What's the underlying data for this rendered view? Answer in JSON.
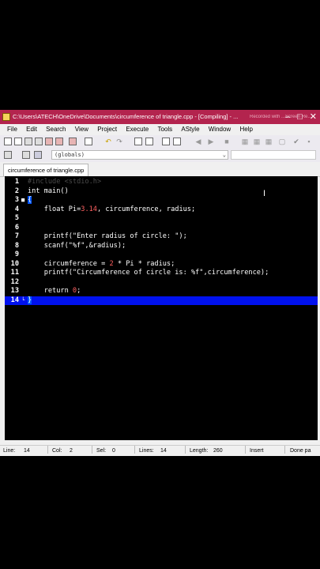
{
  "window": {
    "title": "C:\\Users\\ATECH\\OneDrive\\Documents\\circumference of triangle.cpp - [Compiling] - ...",
    "watermark": "Recorded with ...Screen Re...",
    "buttons": {
      "minimize": "–",
      "maximize": "□",
      "close": "✕"
    }
  },
  "menu": [
    "File",
    "Edit",
    "Search",
    "View",
    "Project",
    "Execute",
    "Tools",
    "AStyle",
    "Window",
    "Help"
  ],
  "toolbar": {
    "scope_combo": "(globals)"
  },
  "tabs": [
    {
      "label": "circumference of triangle.cpp"
    }
  ],
  "editor": {
    "lines": [
      {
        "num": "1",
        "html_parts": [
          {
            "t": "#include <stdio.h>",
            "c": "pp"
          }
        ]
      },
      {
        "num": "2",
        "html_parts": [
          {
            "t": "int main()",
            "c": "kw"
          }
        ]
      },
      {
        "num": "3",
        "html_parts": [
          {
            "t": "{",
            "c": "brace-hl"
          }
        ]
      },
      {
        "num": "4",
        "html_parts": [
          {
            "t": "    float Pi=",
            "c": "kw"
          },
          {
            "t": "3.14",
            "c": "num"
          },
          {
            "t": ", circumference, radius;",
            "c": "kw"
          }
        ]
      },
      {
        "num": "5",
        "html_parts": []
      },
      {
        "num": "6",
        "html_parts": []
      },
      {
        "num": "7",
        "html_parts": [
          {
            "t": "    printf(\"Enter radius of circle: \");",
            "c": "str"
          }
        ]
      },
      {
        "num": "8",
        "html_parts": [
          {
            "t": "    scanf(\"%f\",&radius);",
            "c": "str"
          }
        ]
      },
      {
        "num": "9",
        "html_parts": []
      },
      {
        "num": "10",
        "html_parts": [
          {
            "t": "    circumference = ",
            "c": "kw"
          },
          {
            "t": "2",
            "c": "num"
          },
          {
            "t": " * Pi * radius;",
            "c": "kw"
          }
        ]
      },
      {
        "num": "11",
        "html_parts": [
          {
            "t": "    printf(\"Circumference of circle is: %f\",circumference);",
            "c": "str"
          }
        ]
      },
      {
        "num": "12",
        "html_parts": []
      },
      {
        "num": "13",
        "html_parts": [
          {
            "t": "    return ",
            "c": "kw"
          },
          {
            "t": "0",
            "c": "num"
          },
          {
            "t": ";",
            "c": "kw"
          }
        ]
      },
      {
        "num": "14",
        "html_parts": [
          {
            "t": "}",
            "c": "brace-hl"
          }
        ]
      }
    ],
    "current_line": "14"
  },
  "status": {
    "line": "Line:",
    "line_val": "14",
    "col": "Col:",
    "col_val": "2",
    "sel": "Sel:",
    "sel_val": "0",
    "lines": "Lines:",
    "lines_val": "14",
    "length": "Length:",
    "length_val": "260",
    "mode": "Insert",
    "parse": "Done pa"
  },
  "colors": {
    "titlebar": "#b3244e",
    "editor_bg": "#000000",
    "current_line": "#0011ee",
    "number": "#ff6060"
  }
}
